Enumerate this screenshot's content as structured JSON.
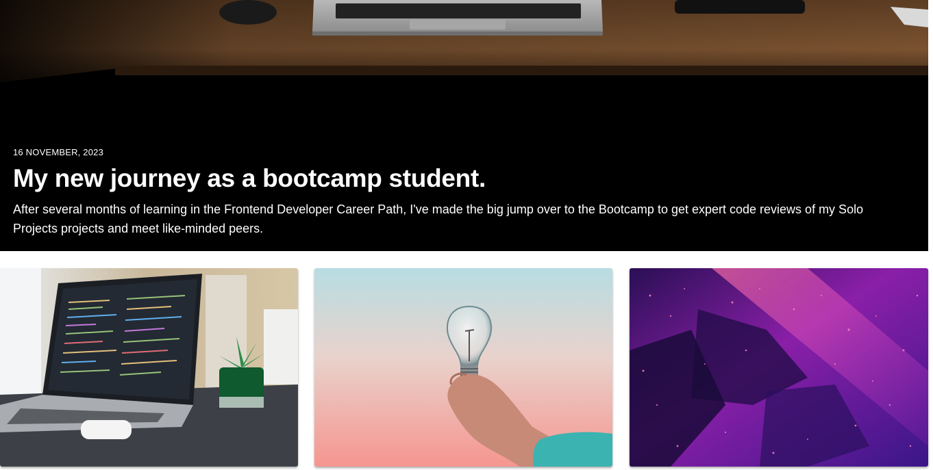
{
  "hero": {
    "date": "16 NOVEMBER, 2023",
    "title": "My new journey as a bootcamp student.",
    "description": "After several months of learning in the Frontend Developer Career Path, I've made the big jump over to the Bootcamp to get expert code reviews of my Solo Projects projects and meet like-minded peers."
  },
  "colors": {
    "hero_background": "#000000",
    "hero_text": "#ffffff",
    "desk_wood": "#7a5230"
  }
}
